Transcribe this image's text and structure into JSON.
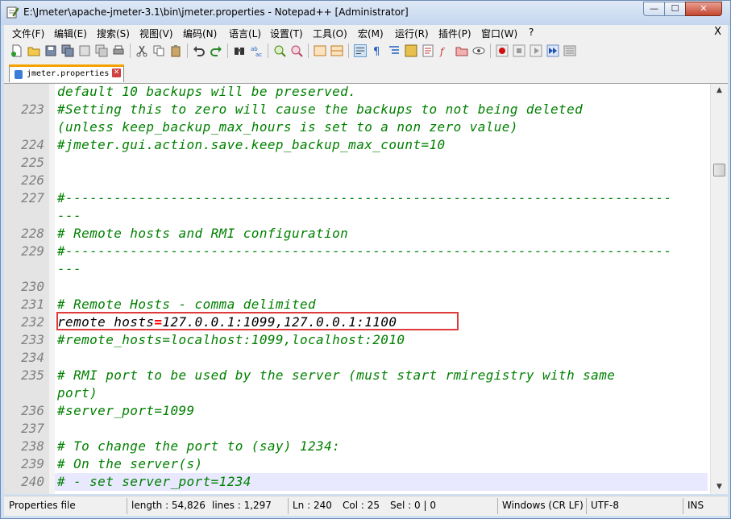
{
  "window": {
    "title": "E:\\Jmeter\\apache-jmeter-3.1\\bin\\jmeter.properties - Notepad++ [Administrator]",
    "minimize_glyph": "—",
    "maximize_glyph": "☐",
    "close_glyph": "✕"
  },
  "menu": {
    "items": [
      "文件(F)",
      "编辑(E)",
      "搜索(S)",
      "视图(V)",
      "编码(N)",
      "语言(L)",
      "设置(T)",
      "工具(O)",
      "宏(M)",
      "运行(R)",
      "插件(P)",
      "窗口(W)",
      "?"
    ],
    "close_x": "X"
  },
  "tab": {
    "label": "jmeter.properties",
    "close_glyph": "✕"
  },
  "editor": {
    "lines": [
      {
        "num": "",
        "text": "default 10 backups will be preserved.",
        "kind": "comment"
      },
      {
        "num": "223",
        "text": "#Setting this to zero will cause the backups to not being deleted",
        "kind": "comment"
      },
      {
        "num": "",
        "text": "(unless keep_backup_max_hours is set to a non zero value)",
        "kind": "comment"
      },
      {
        "num": "224",
        "text": "#jmeter.gui.action.save.keep_backup_max_count=10",
        "kind": "comment"
      },
      {
        "num": "225",
        "text": "",
        "kind": "comment"
      },
      {
        "num": "226",
        "text": "",
        "kind": "comment"
      },
      {
        "num": "227",
        "text": "#---------------------------------------------------------------------------",
        "kind": "comment"
      },
      {
        "num": "",
        "text": "---",
        "kind": "comment"
      },
      {
        "num": "228",
        "text": "# Remote hosts and RMI configuration",
        "kind": "comment"
      },
      {
        "num": "229",
        "text": "#---------------------------------------------------------------------------",
        "kind": "comment"
      },
      {
        "num": "",
        "text": "---",
        "kind": "comment"
      },
      {
        "num": "230",
        "text": "",
        "kind": "comment"
      },
      {
        "num": "231",
        "text": "# Remote Hosts - comma delimited",
        "kind": "comment"
      },
      {
        "num": "232",
        "key": "remote_hosts",
        "eq": "=",
        "value": "127.0.0.1:1099,127.0.0.1:1100",
        "kind": "kv"
      },
      {
        "num": "233",
        "text": "#remote_hosts=localhost:1099,localhost:2010",
        "kind": "comment"
      },
      {
        "num": "234",
        "text": "",
        "kind": "comment"
      },
      {
        "num": "235",
        "text": "# RMI port to be used by the server (must start rmiregistry with same",
        "kind": "comment"
      },
      {
        "num": "",
        "text": "port)",
        "kind": "comment"
      },
      {
        "num": "236",
        "text": "#server_port=1099",
        "kind": "comment"
      },
      {
        "num": "237",
        "text": "",
        "kind": "comment"
      },
      {
        "num": "238",
        "text": "# To change the port to (say) 1234:",
        "kind": "comment"
      },
      {
        "num": "239",
        "text": "# On the server(s)",
        "kind": "comment"
      },
      {
        "num": "240",
        "text": "# - set server_port=1234",
        "kind": "comment",
        "current": true
      }
    ]
  },
  "status": {
    "file_type": "Properties file",
    "length": "length : 54,826",
    "lines": "lines : 1,297",
    "ln": "Ln : 240",
    "col": "Col : 25",
    "sel": "Sel : 0 | 0",
    "eol": "Windows (CR LF)",
    "encoding": "UTF-8",
    "mode": "INS"
  },
  "colors": {
    "comment": "#008000",
    "operator": "#ff0000",
    "highlight_box": "#e03a3a",
    "current_line": "#e8e8ff"
  }
}
